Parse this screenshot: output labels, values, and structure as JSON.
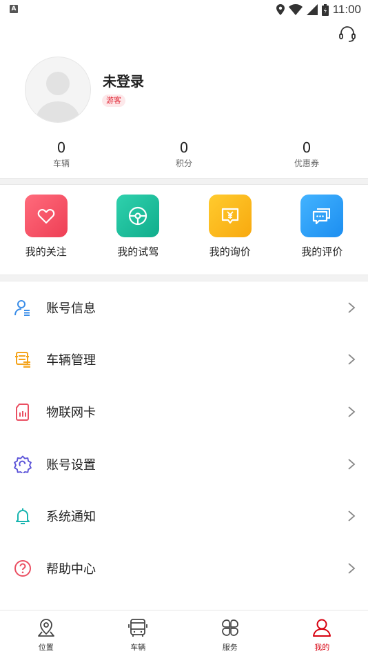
{
  "status_bar": {
    "time": "11:00",
    "left_badge": "A"
  },
  "profile": {
    "name": "未登录",
    "badge": "游客"
  },
  "stats": [
    {
      "value": "0",
      "label": "车辆"
    },
    {
      "value": "0",
      "label": "积分"
    },
    {
      "value": "0",
      "label": "优惠券"
    }
  ],
  "quick_actions": [
    {
      "label": "我的关注",
      "icon": "heart-icon",
      "color": "#f04f62"
    },
    {
      "label": "我的试驾",
      "icon": "steering-wheel-icon",
      "color": "#19b99a"
    },
    {
      "label": "我的询价",
      "icon": "price-tag-icon",
      "color": "#fcb51c"
    },
    {
      "label": "我的评价",
      "icon": "comment-icon",
      "color": "#2e9af5"
    }
  ],
  "menu": [
    {
      "label": "账号信息",
      "icon": "user-info-icon",
      "color": "#3a8de8"
    },
    {
      "label": "车辆管理",
      "icon": "car-manage-icon",
      "color": "#f4a31a"
    },
    {
      "label": "物联网卡",
      "icon": "sim-card-icon",
      "color": "#ea4f62"
    },
    {
      "label": "账号设置",
      "icon": "settings-gear-icon",
      "color": "#5a52d8"
    },
    {
      "label": "系统通知",
      "icon": "bell-icon",
      "color": "#19b5b0"
    },
    {
      "label": "帮助中心",
      "icon": "help-icon",
      "color": "#ea4f62"
    }
  ],
  "tabs": [
    {
      "label": "位置",
      "icon": "location-icon"
    },
    {
      "label": "车辆",
      "icon": "bus-icon"
    },
    {
      "label": "服务",
      "icon": "grid-icon"
    },
    {
      "label": "我的",
      "icon": "person-icon",
      "active": true
    }
  ],
  "accent_color": "#d7000f"
}
